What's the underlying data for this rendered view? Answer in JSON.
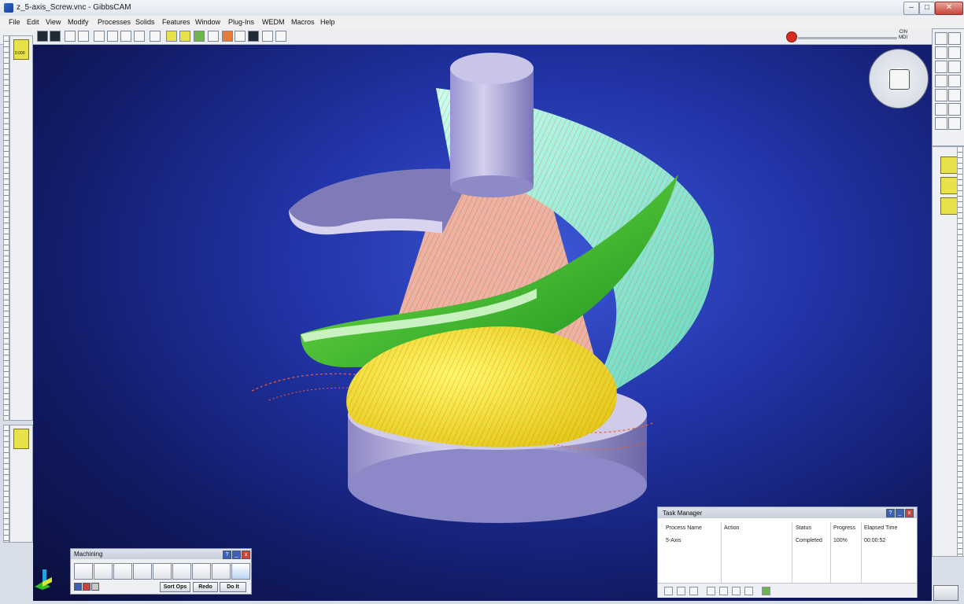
{
  "window": {
    "title": "z_5-axis_Screw.vnc - GibbsCAM"
  },
  "menu": [
    "File",
    "Edit",
    "View",
    "Modify",
    "Processes",
    "Solids",
    "Features",
    "Window",
    "Plug-Ins",
    "WEDM",
    "Macros",
    "Help"
  ],
  "status": {
    "line1": "CIN",
    "line2": "MDI"
  },
  "left_palette": {
    "tile_label": "0.000"
  },
  "machining": {
    "title": "Machining",
    "buttons": [
      "Sort Ops",
      "Redo",
      "Do It"
    ]
  },
  "task_manager": {
    "title": "Task Manager",
    "columns": [
      "Process Name",
      "Action",
      "Status",
      "Progress",
      "Elapsed Time"
    ],
    "rows": [
      {
        "process": "5-Axis",
        "action": "",
        "status": "Completed",
        "progress": "100%",
        "elapsed": "00:00:52"
      }
    ]
  },
  "colors": {
    "viewport_center": "#3b56d4",
    "viewport_edge": "#0b0f3b",
    "toolpath": "#ff5a1e",
    "blade_green": "#2fbf2a",
    "blade_cyan": "#7ff0d6",
    "surface_yellow": "#f2ea30",
    "stock": "#b9b4dc"
  }
}
